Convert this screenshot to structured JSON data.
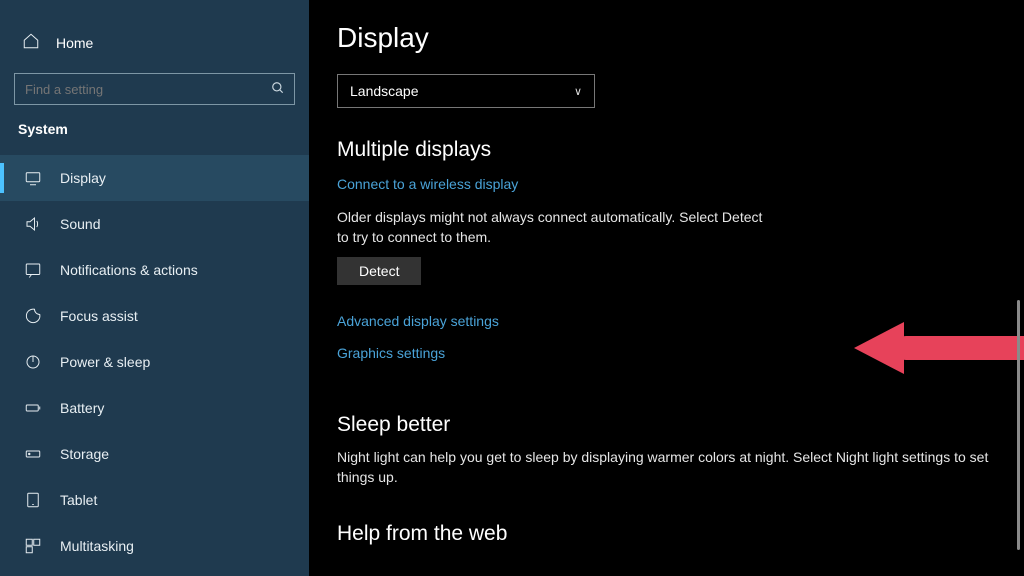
{
  "sidebar": {
    "home": "Home",
    "search_placeholder": "Find a setting",
    "category": "System",
    "items": [
      {
        "label": "Display"
      },
      {
        "label": "Sound"
      },
      {
        "label": "Notifications & actions"
      },
      {
        "label": "Focus assist"
      },
      {
        "label": "Power & sleep"
      },
      {
        "label": "Battery"
      },
      {
        "label": "Storage"
      },
      {
        "label": "Tablet"
      },
      {
        "label": "Multitasking"
      }
    ]
  },
  "main": {
    "title": "Display",
    "orientation_value": "Landscape",
    "multiple_heading": "Multiple displays",
    "link_wireless": "Connect to a wireless display",
    "older_text": "Older displays might not always connect automatically. Select Detect to try to connect to them.",
    "detect_label": "Detect",
    "link_advanced": "Advanced display settings",
    "link_graphics": "Graphics settings",
    "sleep_heading": "Sleep better",
    "sleep_text": "Night light can help you get to sleep by displaying warmer colors at night. Select Night light settings to set things up.",
    "help_heading": "Help from the web"
  },
  "annotation": {
    "arrow_color": "#e7425a"
  }
}
